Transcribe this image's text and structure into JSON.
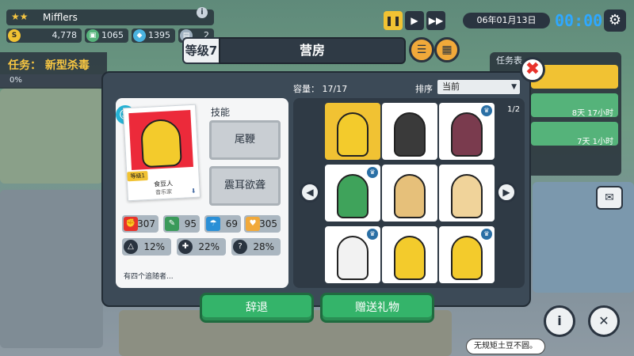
{
  "hud": {
    "player_name": "Mifflers",
    "info_icon": "i",
    "resources": [
      {
        "value": "4,778",
        "icon": "coin-icon",
        "symbol": "S",
        "color": "#f1c233"
      },
      {
        "value": "1065",
        "icon": "cpu-icon",
        "symbol": "▣",
        "color": "#55b37a"
      },
      {
        "value": "1395",
        "icon": "gem-icon",
        "symbol": "◆",
        "color": "#4ab3e0"
      },
      {
        "value": "2",
        "icon": "card-icon",
        "symbol": "▤",
        "color": "#9fb0bf"
      }
    ],
    "date": "06年01月13日",
    "clock": "00:00"
  },
  "mission": {
    "title": "任务： 新型杀毒",
    "progress": "0%"
  },
  "task_panel": {
    "title": "任务表",
    "items": [
      {
        "time": ""
      },
      {
        "time": "8天 17小时"
      },
      {
        "time": "7天 1小时"
      }
    ]
  },
  "dialog": {
    "level": "等级7",
    "room_name": "营房",
    "capacity": "容量： 17/17",
    "sort_label": "排序",
    "sort_value": "当前",
    "page": "1/2"
  },
  "character": {
    "level_tag": "等级1",
    "name": "食豆人",
    "job": "音乐家",
    "skills_label": "技能",
    "skills": [
      "尾鞭",
      "震耳欲聋"
    ],
    "stats": [
      {
        "value": "307",
        "icon": "fist-icon",
        "symbol": "✊",
        "color": "#e8322b"
      },
      {
        "value": "95",
        "icon": "bulb-icon",
        "symbol": "✎",
        "color": "#3a9a5a"
      },
      {
        "value": "69",
        "icon": "hat-icon",
        "symbol": "☂",
        "color": "#2a8fd6"
      },
      {
        "value": "305",
        "icon": "heart-icon",
        "symbol": "♥",
        "color": "#f1a93a"
      }
    ],
    "percents": [
      {
        "value": "12%",
        "icon": "dodge-icon",
        "symbol": "△"
      },
      {
        "value": "22%",
        "icon": "shield-icon",
        "symbol": "✚"
      },
      {
        "value": "28%",
        "icon": "crit-icon",
        "symbol": "?"
      }
    ],
    "followers": "有四个追随者..."
  },
  "grid": [
    {
      "color": "#f3cb2c",
      "crown": false,
      "selected": true
    },
    {
      "color": "#3a3a3a",
      "crown": false,
      "selected": false
    },
    {
      "color": "#7a3b4e",
      "crown": true,
      "selected": false
    },
    {
      "color": "#3fa35b",
      "crown": true,
      "selected": false
    },
    {
      "color": "#e6c07a",
      "crown": false,
      "selected": false
    },
    {
      "color": "#f0d39a",
      "crown": false,
      "selected": false
    },
    {
      "color": "#f2f2f2",
      "crown": true,
      "selected": false
    },
    {
      "color": "#f3cb2c",
      "crown": false,
      "selected": false
    },
    {
      "color": "#f3cb2c",
      "crown": true,
      "selected": false
    }
  ],
  "actions": {
    "dismiss": "辞退",
    "gift": "赠送礼物"
  },
  "speech_bubble": "无规矩土豆不圆。"
}
